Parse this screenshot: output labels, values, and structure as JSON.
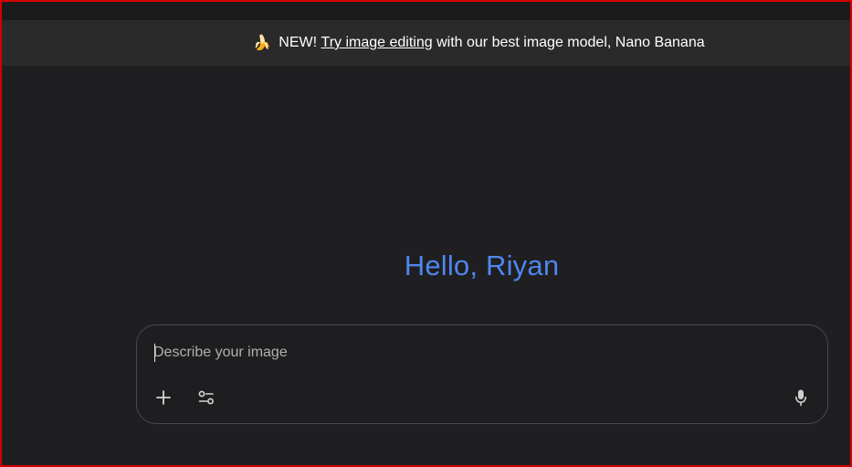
{
  "banner": {
    "emoji": "🍌",
    "prefix": "NEW!",
    "link_text": "Try image editing",
    "suffix": "with our best image model, Nano Banana"
  },
  "greeting": "Hello, Riyan",
  "prompt": {
    "placeholder": "Describe your image",
    "value": ""
  },
  "icons": {
    "add": "plus-icon",
    "tools": "tune-icon",
    "voice": "mic-icon"
  },
  "colors": {
    "background": "#1f1f21",
    "banner_bg": "#2a2a2a",
    "greeting": "#4f86ec",
    "window_border": "#d40000"
  }
}
